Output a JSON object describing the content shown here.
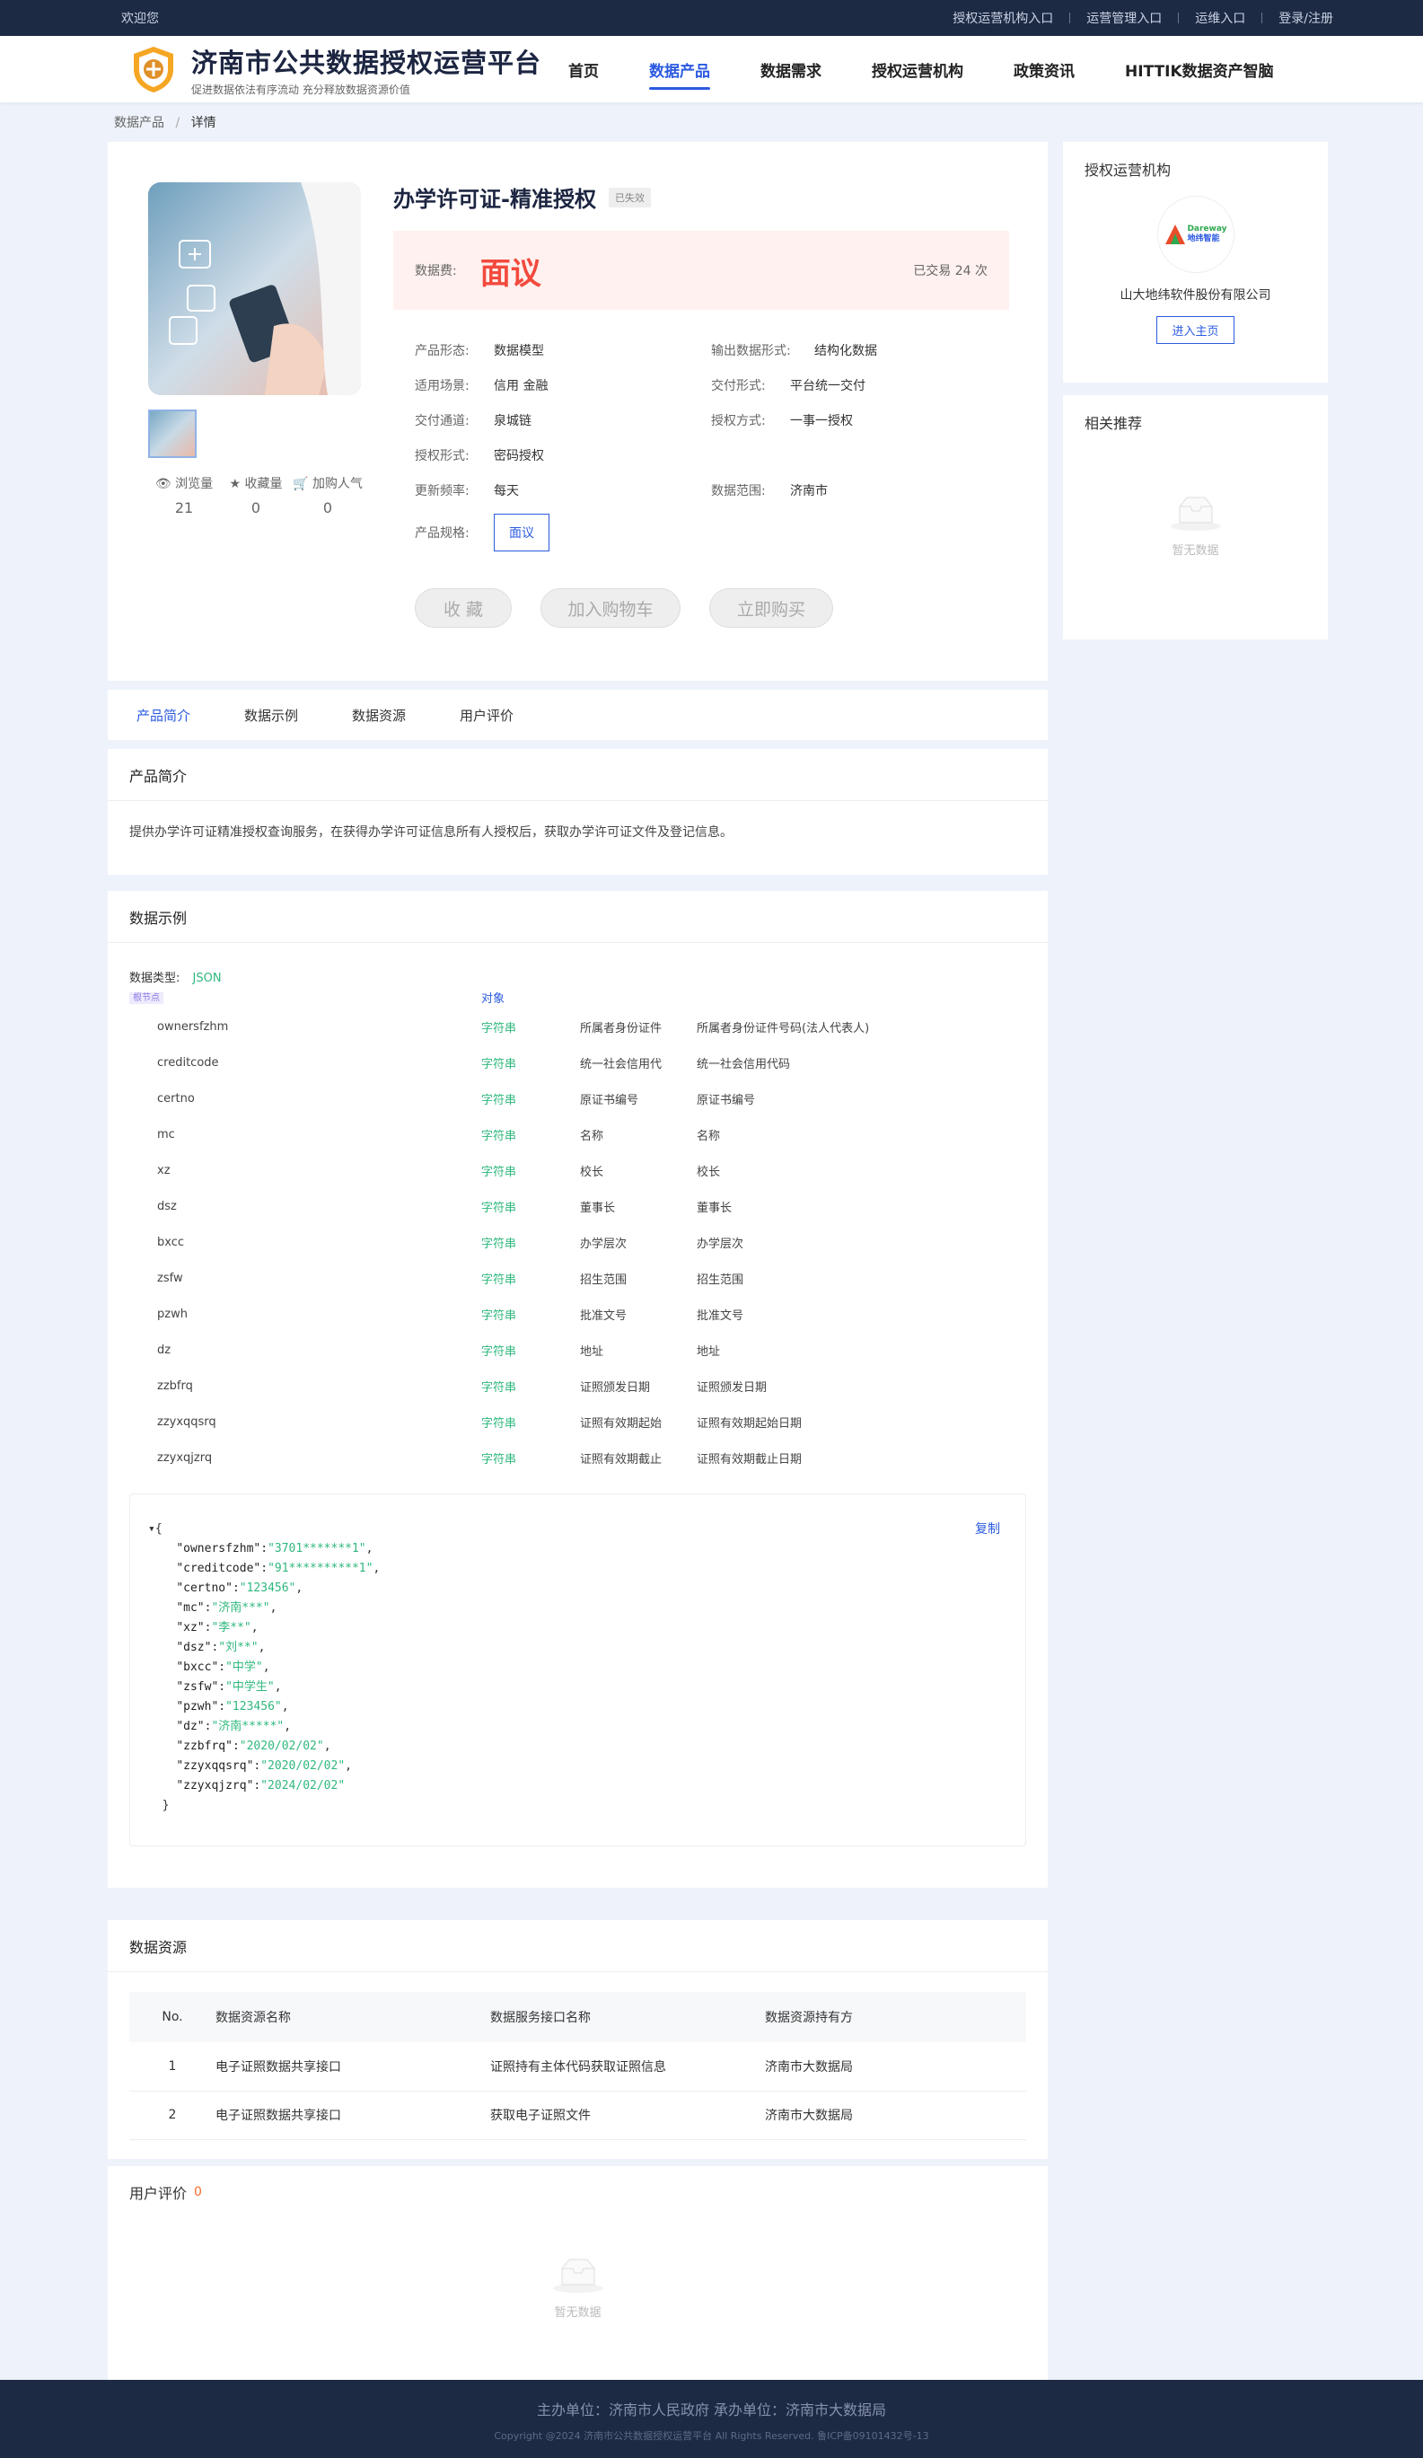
{
  "topbar": {
    "welcome": "欢迎您",
    "links": [
      "授权运营机构入口",
      "运营管理入口",
      "运维入口",
      "登录/注册"
    ]
  },
  "header": {
    "title": "济南市公共数据授权运营平台",
    "subtitle": "促进数据依法有序流动 充分释放数据资源价值",
    "nav": [
      "首页",
      "数据产品",
      "数据需求",
      "授权运营机构",
      "政策资讯",
      "HITTIK数据资产智脑"
    ]
  },
  "breadcrumb": {
    "parent": "数据产品",
    "sep": "/",
    "current": "详情"
  },
  "product": {
    "title": "办学许可证-精准授权",
    "status": "已失效",
    "price_label": "数据费:",
    "price": "面议",
    "deals": "已交易 24 次",
    "stats": [
      {
        "label": "浏览量",
        "value": "21"
      },
      {
        "label": "收藏量",
        "value": "0"
      },
      {
        "label": "加购人气",
        "value": "0"
      }
    ],
    "attrs": [
      {
        "k": "产品形态:",
        "v": "数据模型",
        "k2": "输出数据形式:",
        "v2": "结构化数据"
      },
      {
        "k": "适用场景:",
        "v": "信用  金融",
        "k2": "交付形式:",
        "v2": "平台统一交付"
      },
      {
        "k": "交付通道:",
        "v": "泉城链",
        "k2": "授权方式:",
        "v2": "一事一授权"
      },
      {
        "k": "授权形式:",
        "v": "密码授权",
        "k2": "",
        "v2": ""
      },
      {
        "k": "更新频率:",
        "v": "每天",
        "k2": "数据范围:",
        "v2": "济南市"
      }
    ],
    "spec_label": "产品规格:",
    "spec": "面议",
    "buttons": [
      "收 藏",
      "加入购物车",
      "立即购买"
    ]
  },
  "tabs": [
    "产品简介",
    "数据示例",
    "数据资源",
    "用户评价"
  ],
  "intro": {
    "title": "产品简介",
    "text": "提供办学许可证精准授权查询服务，在获得办学许可证信息所有人授权后，获取办学许可证文件及登记信息。"
  },
  "example": {
    "title": "数据示例",
    "type_label": "数据类型:",
    "type": "JSON",
    "root": "根节点",
    "root_type": "对象",
    "fields": [
      [
        "ownersfzhm",
        "字符串",
        "所属者身份证件",
        "所属者身份证件号码(法人代表人)"
      ],
      [
        "creditcode",
        "字符串",
        "统一社会信用代",
        "统一社会信用代码"
      ],
      [
        "certno",
        "字符串",
        "原证书编号",
        "原证书编号"
      ],
      [
        "mc",
        "字符串",
        "名称",
        "名称"
      ],
      [
        "xz",
        "字符串",
        "校长",
        "校长"
      ],
      [
        "dsz",
        "字符串",
        "董事长",
        "董事长"
      ],
      [
        "bxcc",
        "字符串",
        "办学层次",
        "办学层次"
      ],
      [
        "zsfw",
        "字符串",
        "招生范围",
        "招生范围"
      ],
      [
        "pzwh",
        "字符串",
        "批准文号",
        "批准文号"
      ],
      [
        "dz",
        "字符串",
        "地址",
        "地址"
      ],
      [
        "zzbfrq",
        "字符串",
        "证照颁发日期",
        "证照颁发日期"
      ],
      [
        "zzyxqqsrq",
        "字符串",
        "证照有效期起始",
        "证照有效期起始日期"
      ],
      [
        "zzyxqjzrq",
        "字符串",
        "证照有效期截止",
        "证照有效期截止日期"
      ]
    ],
    "copy": "复制",
    "json": [
      [
        "ownersfzhm",
        "3701*******1"
      ],
      [
        "creditcode",
        "91**********1"
      ],
      [
        "certno",
        "123456"
      ],
      [
        "mc",
        "济南***"
      ],
      [
        "xz",
        "李**"
      ],
      [
        "dsz",
        "刘**"
      ],
      [
        "bxcc",
        "中学"
      ],
      [
        "zsfw",
        "中学生"
      ],
      [
        "pzwh",
        "123456"
      ],
      [
        "dz",
        "济南*****"
      ],
      [
        "zzbfrq",
        "2020/02/02"
      ],
      [
        "zzyxqqsrq",
        "2020/02/02"
      ],
      [
        "zzyxqjzrq",
        "2024/02/02"
      ]
    ]
  },
  "resources": {
    "title": "数据资源",
    "headers": [
      "No.",
      "数据资源名称",
      "数据服务接口名称",
      "数据资源持有方"
    ],
    "rows": [
      [
        "1",
        "电子证照数据共享接口",
        "证照持有主体代码获取证照信息",
        "济南市大数据局"
      ],
      [
        "2",
        "电子证照数据共享接口",
        "获取电子证照文件",
        "济南市大数据局"
      ]
    ]
  },
  "reviews": {
    "title": "用户评价",
    "count": "0",
    "empty": "暂无数据"
  },
  "side": {
    "org_title": "授权运营机构",
    "org_name": "山大地纬软件股份有限公司",
    "org_logo_text": "地纬智能",
    "org_logo_en": "Dareway",
    "org_btn": "进入主页",
    "rec_title": "相关推荐",
    "rec_empty": "暂无数据"
  },
  "footer": {
    "line1": "主办单位：济南市人民政府    承办单位：济南市大数据局",
    "line2": "Copyright @2024 济南市公共数据授权运营平台 All Rights Reserved. 鲁ICP备09101432号-13"
  },
  "colors": {
    "accent": "#2b5ae0",
    "price": "#f24a3d",
    "string_type": "#2fb87d",
    "topbar": "#1d2a44"
  }
}
